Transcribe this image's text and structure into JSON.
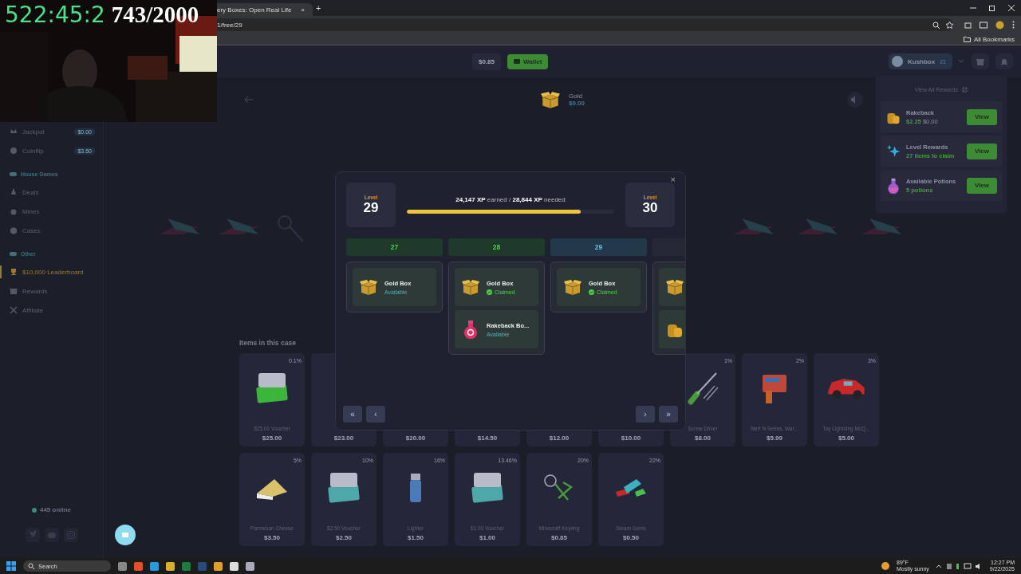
{
  "browser": {
    "tab": {
      "title": "ery Boxes: Open Real Life",
      "close": "×"
    },
    "new_tab": "+",
    "address": "1/free/29",
    "bookmarks": "All Bookmarks"
  },
  "stream_overlay": {
    "timer": "522:45:2",
    "count": "743/2000"
  },
  "header": {
    "balance": "$0.85",
    "wallet": "Wallet",
    "user": {
      "name": "Kushbox",
      "level": "21"
    }
  },
  "sidebar": {
    "items": [
      {
        "kind": "link",
        "label": "Jackpot",
        "badge": "$0.00",
        "selected": false
      },
      {
        "kind": "link",
        "label": "Coinflip",
        "badge": "$3.50",
        "selected": false
      },
      {
        "kind": "heading",
        "label": "House Games"
      },
      {
        "kind": "link",
        "label": "Deals",
        "selected": false
      },
      {
        "kind": "link",
        "label": "Mines",
        "selected": false
      },
      {
        "kind": "link",
        "label": "Cases",
        "selected": false
      },
      {
        "kind": "heading",
        "label": "Other"
      },
      {
        "kind": "link",
        "label": "$10,000 Leaderboard",
        "selected": true
      },
      {
        "kind": "link",
        "label": "Rewards",
        "selected": false
      },
      {
        "kind": "link",
        "label": "Affiliate",
        "selected": false
      }
    ],
    "online": "445 online"
  },
  "case": {
    "name": "Gold",
    "price": "$0.00"
  },
  "items_title": "Items in this case",
  "items": [
    {
      "name": "$25.00 Voucher",
      "price": "$25.00",
      "chance": "0.1%"
    },
    {
      "price": "$23.00"
    },
    {
      "price": "$20.00"
    },
    {
      "price": "$14.50"
    },
    {
      "price": "$12.00"
    },
    {
      "price": "$10.00"
    },
    {
      "name": "Screw Driver",
      "price": "$8.00",
      "chance": "1%"
    },
    {
      "name": "Nerf N Series, War...",
      "price": "$5.99",
      "chance": "2%"
    },
    {
      "name": "Toy Lightning McQ...",
      "price": "$5.00",
      "chance": "3%"
    },
    {
      "name": "Parmesan Cheese",
      "price": "$3.50",
      "chance": "5%"
    },
    {
      "name": "$2.50 Voucher",
      "price": "$2.50",
      "chance": "10%"
    },
    {
      "name": "Lighter",
      "price": "$1.50",
      "chance": "16%"
    },
    {
      "name": "$1.00 Voucher",
      "price": "$1.00",
      "chance": "13.46%"
    },
    {
      "name": "Minecraft Keyring",
      "price": "$0.85",
      "chance": "20%"
    },
    {
      "name": "Steam Gems",
      "price": "$0.50",
      "chance": "22%"
    }
  ],
  "rewards_menu": {
    "view_all": "View All Rewards",
    "rows": [
      {
        "title": "Rakeback",
        "value": "$2.25",
        "secondary": "$0.00",
        "button": "View"
      },
      {
        "title": "Level Rewards",
        "value": "27 items to claim",
        "button": "View"
      },
      {
        "title": "Available Potions",
        "value": "5 potions",
        "button": "View"
      }
    ]
  },
  "level_modal": {
    "close": "×",
    "current_level": {
      "label": "Level",
      "value": "29"
    },
    "next_level": {
      "label": "Level",
      "value": "30"
    },
    "xp": "**24,147 XP** earned / **28,844 XP** needed",
    "level": 0.84,
    "columns": [
      {
        "level": "27",
        "kind": "reached",
        "items": [
          {
            "kind": "gold-box",
            "name": "Gold Box",
            "status": "Available",
            "claimed": false
          }
        ]
      },
      {
        "level": "28",
        "kind": "reached",
        "items": [
          {
            "kind": "gold-box",
            "name": "Gold Box",
            "status": "Claimed",
            "claimed": true
          },
          {
            "kind": "potion",
            "name": "Rakeback Bo...",
            "status": "Available",
            "claimed": false
          }
        ]
      },
      {
        "level": "29",
        "kind": "current",
        "items": [
          {
            "kind": "gold-box",
            "name": "Gold Box",
            "status": "Claimed",
            "claimed": true
          }
        ]
      },
      {
        "kind": "locked",
        "items": [
          {
            "kind": "gold-box"
          },
          {
            "kind": "coins"
          }
        ]
      }
    ],
    "nav": [
      "«",
      "‹",
      "›",
      "»"
    ]
  },
  "taskbar": {
    "search": "Search",
    "weather": {
      "temp": "89°F",
      "text": "Mostly sunny"
    },
    "time": "12:27 PM",
    "date": "9/22/2025"
  }
}
